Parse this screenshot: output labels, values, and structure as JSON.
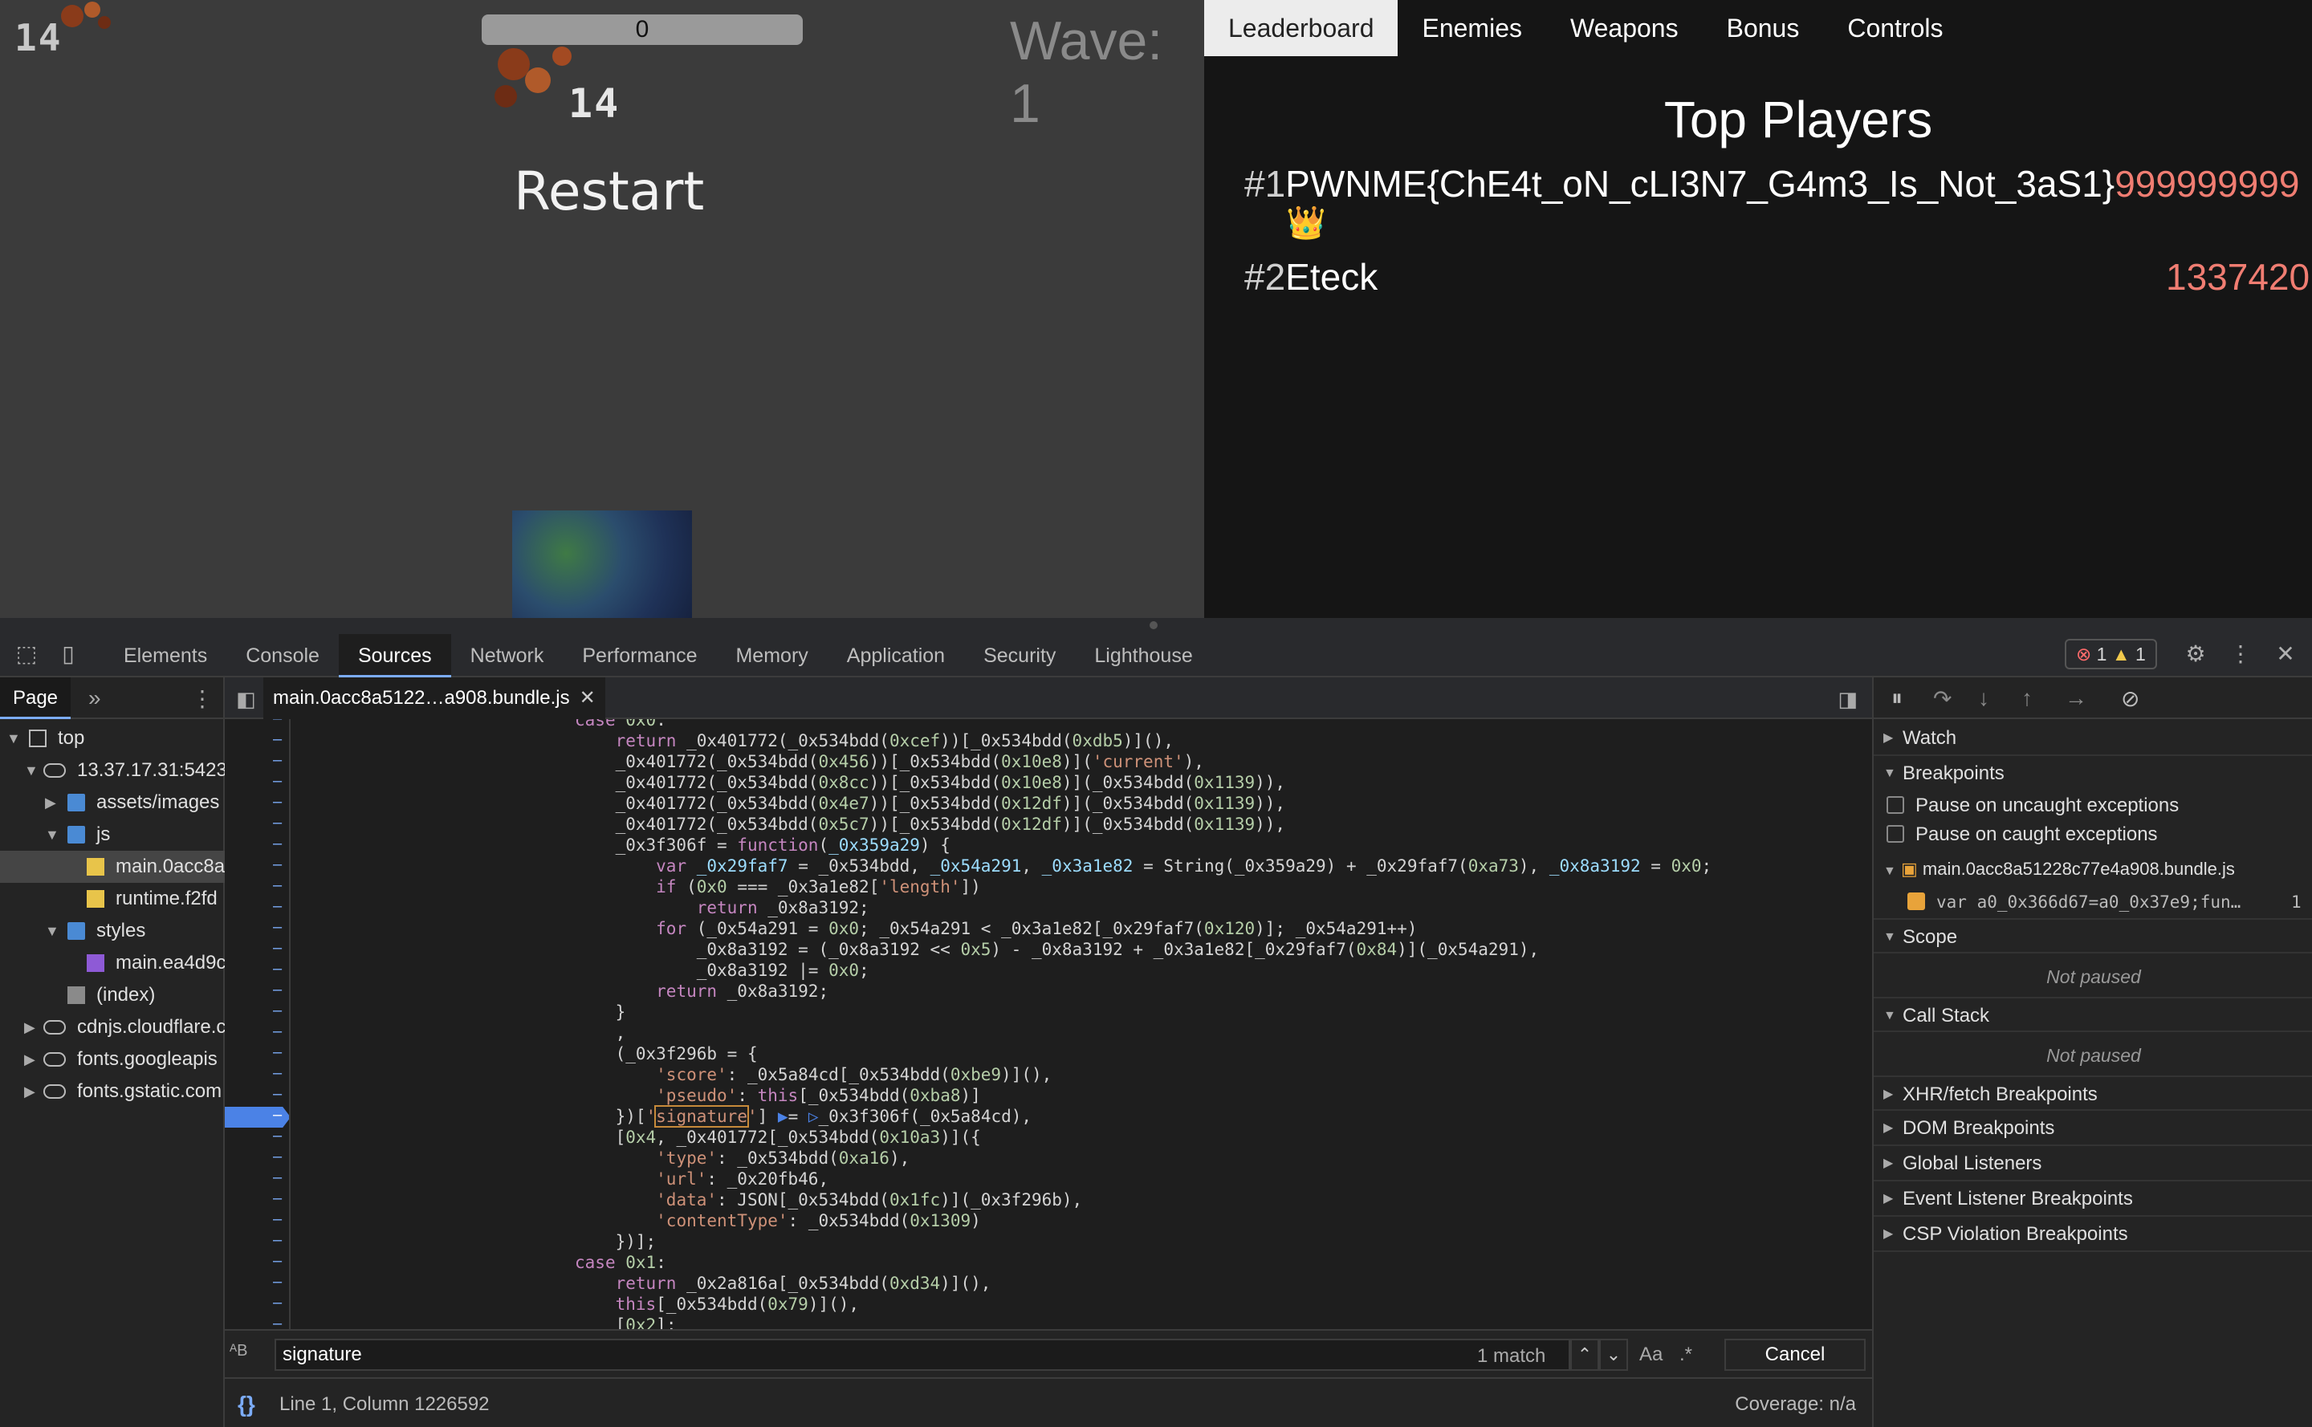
{
  "game": {
    "corner_score": "14",
    "progress_value": "0",
    "wave": "Wave: 1",
    "center_score": "14",
    "restart": "Restart"
  },
  "panel": {
    "tabs": [
      "Leaderboard",
      "Enemies",
      "Weapons",
      "Bonus",
      "Controls"
    ],
    "active_tab": "Leaderboard",
    "title": "Top Players",
    "players": [
      {
        "rank": "#1",
        "name": "PWNME{ChE4t_oN_cLI3N7_G4m3_Is_Not_3aS1}",
        "score": "999999999",
        "badge": "👑"
      },
      {
        "rank": "#2",
        "name": "Eteck",
        "score": "1337420"
      }
    ]
  },
  "devtools": {
    "tabs": [
      "Elements",
      "Console",
      "Sources",
      "Network",
      "Performance",
      "Memory",
      "Application",
      "Security",
      "Lighthouse"
    ],
    "active_tab": "Sources",
    "errors": "1",
    "warnings": "1",
    "navigator": {
      "page_tab": "Page",
      "more": "»",
      "tree": [
        {
          "label": "top",
          "icon": "frame"
        },
        {
          "label": "13.37.17.31:5423",
          "icon": "cloud"
        },
        {
          "label": "assets/images",
          "icon": "folder"
        },
        {
          "label": "js",
          "icon": "folder"
        },
        {
          "label": "main.0acc8a",
          "icon": "jsfile"
        },
        {
          "label": "runtime.f2fd",
          "icon": "jsfile"
        },
        {
          "label": "styles",
          "icon": "folder"
        },
        {
          "label": "main.ea4d9c",
          "icon": "cssfile"
        },
        {
          "label": "(index)",
          "icon": "docfile"
        },
        {
          "label": "cdnjs.cloudflare.c",
          "icon": "cloud"
        },
        {
          "label": "fonts.googleapis",
          "icon": "cloud"
        },
        {
          "label": "fonts.gstatic.com",
          "icon": "cloud"
        }
      ]
    },
    "editor": {
      "file_tab": "main.0acc8a5122…a908.bundle.js",
      "search_query": "signature",
      "match_count": "1 match",
      "case_toggle": "Aa",
      "regex_toggle": ".*",
      "cancel": "Cancel",
      "cursor": "Line 1, Column 1226592",
      "coverage": "Coverage: n/a"
    },
    "debugger": {
      "watch": "Watch",
      "breakpoints": "Breakpoints",
      "pause_uncaught": "Pause on uncaught exceptions",
      "pause_caught": "Pause on caught exceptions",
      "bp_file": "main.0acc8a51228c77e4a908.bundle.js",
      "bp_code": "var a0_0x366d67=a0_0x37e9;fun…",
      "bp_line": "1",
      "scope": "Scope",
      "scope_status": "Not paused",
      "call_stack": "Call Stack",
      "call_stack_status": "Not paused",
      "sections": [
        "XHR/fetch Breakpoints",
        "DOM Breakpoints",
        "Global Listeners",
        "Event Listener Breakpoints",
        "CSP Violation Breakpoints"
      ]
    }
  }
}
